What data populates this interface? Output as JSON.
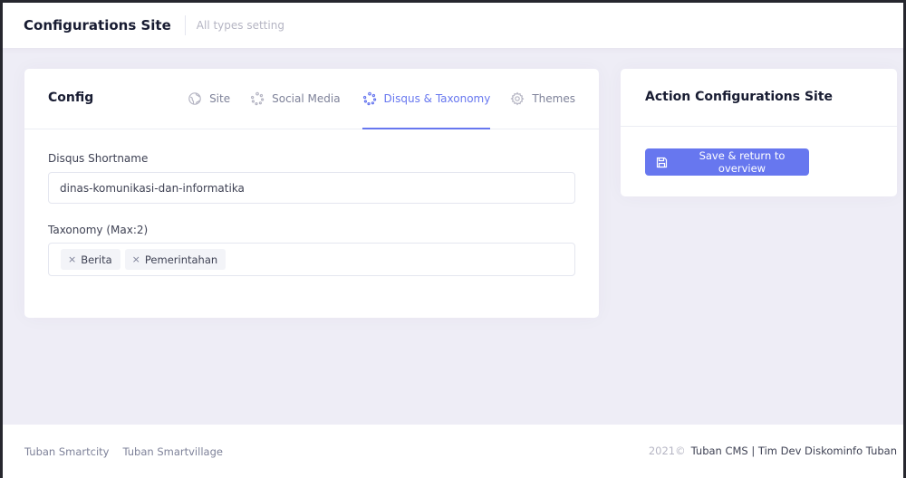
{
  "subheader": {
    "title": "Configurations Site",
    "description": "All types setting"
  },
  "config_card": {
    "title": "Config",
    "tabs": [
      {
        "label": "Site",
        "icon": "globe-icon",
        "active": false
      },
      {
        "label": "Social Media",
        "icon": "spinner-icon",
        "active": false
      },
      {
        "label": "Disqus & Taxonomy",
        "icon": "spinner-icon",
        "active": true
      },
      {
        "label": "Themes",
        "icon": "gear-icon",
        "active": false
      }
    ],
    "disqus_label": "Disqus Shortname",
    "disqus_value": "dinas-komunikasi-dan-informatika",
    "taxonomy_label": "Taxonomy (Max:2)",
    "taxonomy_tags": [
      "Berita",
      "Pemerintahan"
    ],
    "tag_remove_symbol": "×"
  },
  "action_card": {
    "title": "Action Configurations Site",
    "save_label": "Save & return to overview",
    "save_icon": "floppy-disk-icon"
  },
  "footer": {
    "links": [
      "Tuban Smartcity",
      "Tuban Smartvillage"
    ],
    "year": "2021©",
    "org": "Tuban CMS | Tim Dev Diskominfo Tuban"
  },
  "colors": {
    "accent": "#6777ef",
    "page_bg": "#eeedf6",
    "title": "#181c32",
    "muted": "#7e8299"
  }
}
